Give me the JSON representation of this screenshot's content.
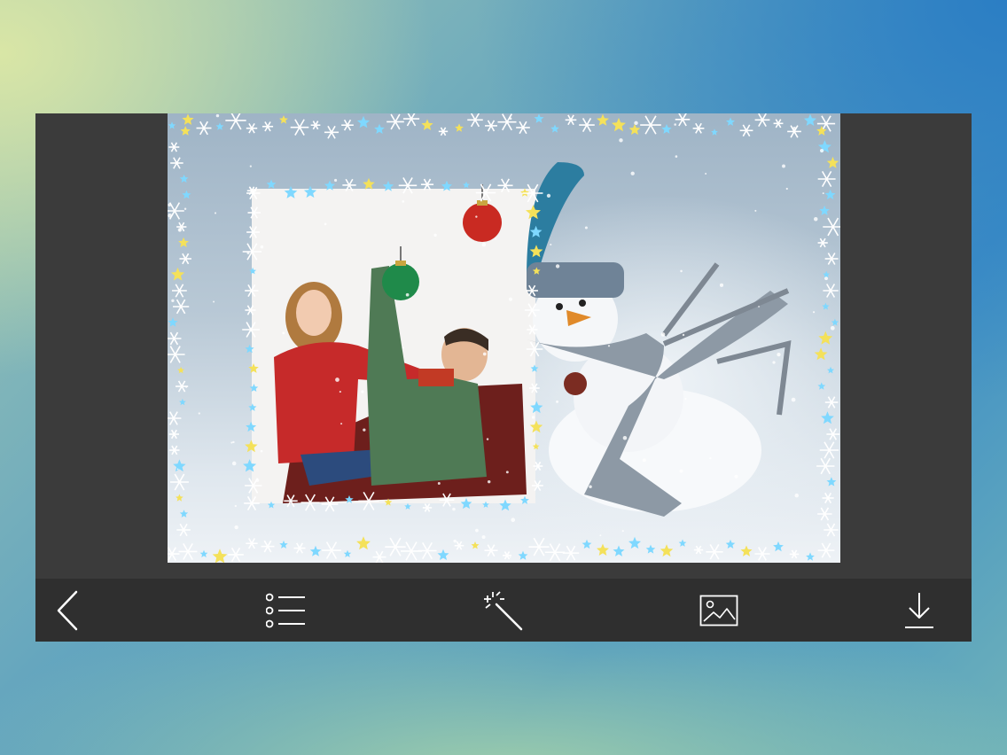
{
  "editor": {
    "photo": {
      "frame": "snowflake-frame",
      "scene": "couple-with-snowman"
    }
  },
  "toolbar": {
    "buttons": [
      {
        "id": "back",
        "icon": "chevron-left-icon"
      },
      {
        "id": "frames",
        "icon": "list-icon"
      },
      {
        "id": "effects",
        "icon": "magic-wand-icon"
      },
      {
        "id": "gallery",
        "icon": "image-icon"
      },
      {
        "id": "save",
        "icon": "download-icon"
      }
    ]
  },
  "colors": {
    "toolbar_bg": "#2f2f2f",
    "window_bg": "#3b3b3b",
    "icon": "#ffffff"
  }
}
